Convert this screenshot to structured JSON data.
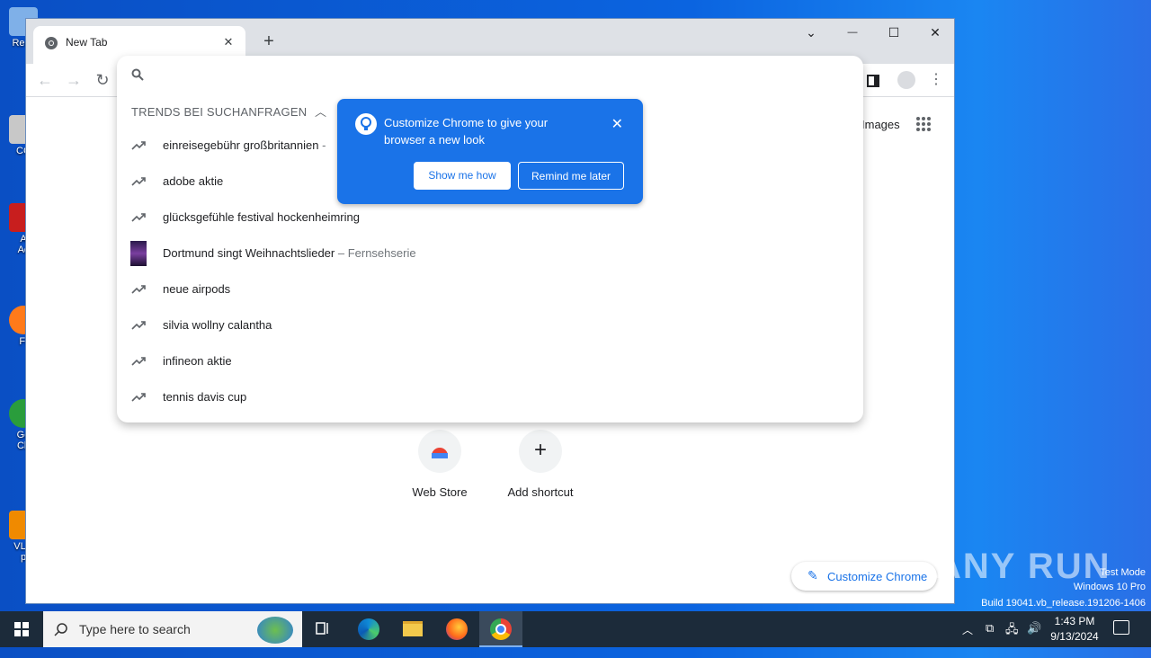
{
  "desktop": {
    "icons": [
      {
        "label": "Recy",
        "color": "#4a8fd8"
      },
      {
        "label": "CC",
        "color": "#c8c8c8"
      },
      {
        "label": "A",
        "sub": "Ac",
        "color": "#c81e1e"
      },
      {
        "label": "Fi",
        "color": "#ff7a1a"
      },
      {
        "label": "Go",
        "sub": "Ch",
        "color": "#2a9d3c"
      },
      {
        "label": "VLC",
        "sub": "p",
        "color": "#f08a00"
      }
    ]
  },
  "browser": {
    "tab_title": "New Tab",
    "tab_close": "✕",
    "new_tab": "+",
    "window_controls": {
      "dropdown": "⌄",
      "minimize": "—",
      "maximize": "☐",
      "close": "✕"
    }
  },
  "omnibox": {
    "section_header": "TRENDS BEI SUCHANFRAGEN",
    "suggestions": [
      {
        "text": "einreisegebühr großbritannien",
        "sub": " -",
        "icon": "trending-icon"
      },
      {
        "text": "adobe aktie",
        "sub": "",
        "icon": "trending-icon"
      },
      {
        "text": "glücksgefühle festival hockenheimring",
        "sub": "",
        "icon": "trending-icon"
      },
      {
        "text": "Dortmund singt Weihnachtslieder",
        "sub": " – Fernsehserie",
        "icon": "thumbnail"
      },
      {
        "text": "neue airpods",
        "sub": "",
        "icon": "trending-icon"
      },
      {
        "text": "silvia wollny calantha",
        "sub": "",
        "icon": "trending-icon"
      },
      {
        "text": "infineon aktie",
        "sub": "",
        "icon": "trending-icon"
      },
      {
        "text": "tennis davis cup",
        "sub": "",
        "icon": "trending-icon"
      }
    ]
  },
  "promo": {
    "message": "Customize Chrome to give your browser a new look",
    "primary_button": "Show me how",
    "secondary_button": "Remind me later"
  },
  "ntp": {
    "images_link": "Images",
    "shortcuts": [
      {
        "label": "Web Store"
      },
      {
        "label": "Add shortcut"
      }
    ],
    "customize_button": "Customize Chrome"
  },
  "watermark": {
    "brand": "ANY RUN",
    "line1": "Test Mode",
    "line2": "Windows 10 Pro",
    "line3": "Build 19041.vb_release.191206-1406"
  },
  "taskbar": {
    "search_placeholder": "Type here to search",
    "time": "1:43 PM",
    "date": "9/13/2024"
  },
  "colors": {
    "accent": "#1a73e8",
    "desktop": "#0b64e0",
    "taskbar": "#1c2b3a"
  }
}
